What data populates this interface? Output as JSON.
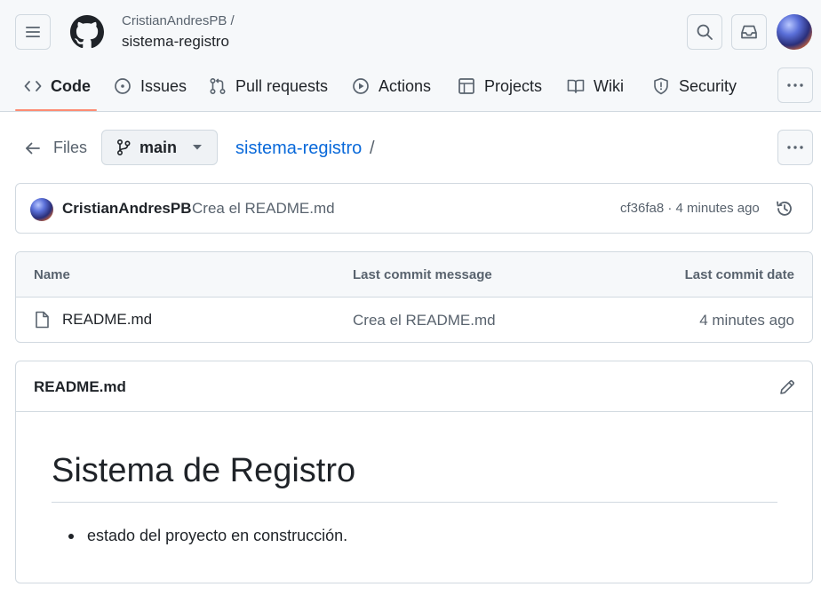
{
  "header": {
    "owner": "CristianAndresPB /",
    "repo": "sistema-registro"
  },
  "tabs": [
    {
      "label": "Code",
      "icon": "code-icon",
      "active": true
    },
    {
      "label": "Issues",
      "icon": "issue-opened-icon"
    },
    {
      "label": "Pull requests",
      "icon": "git-pull-request-icon"
    },
    {
      "label": "Actions",
      "icon": "play-icon"
    },
    {
      "label": "Projects",
      "icon": "table-icon"
    },
    {
      "label": "Wiki",
      "icon": "book-icon"
    },
    {
      "label": "Security",
      "icon": "shield-icon"
    }
  ],
  "files_bar": {
    "files_label": "Files",
    "branch": "main",
    "path": "sistema-registro",
    "separator": "/"
  },
  "commit": {
    "author": "CristianAndresPB",
    "message": "Crea el README.md",
    "meta": "cf36fa8 · 4 minutes ago"
  },
  "table": {
    "headers": [
      "Name",
      "Last commit message",
      "Last commit date"
    ],
    "rows": [
      {
        "name": "README.md",
        "message": "Crea el README.md",
        "date": "4 minutes ago",
        "icon": "file-icon"
      }
    ]
  },
  "readme": {
    "filename": "README.md",
    "heading": "Sistema de Registro",
    "items": [
      "estado del proyecto en construcción."
    ]
  },
  "colors": {
    "link": "#0969da",
    "active_tab_underline": "#fd8c73",
    "muted": "#59636e",
    "border": "#d1d9e0"
  }
}
